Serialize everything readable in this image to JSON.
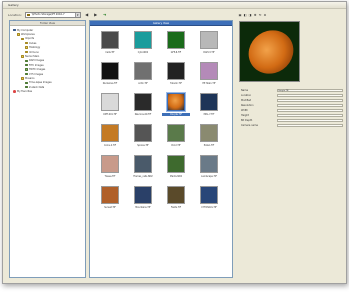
{
  "window": {
    "title": "Gallery"
  },
  "toolbar": {
    "location_label": "Location:",
    "location_value": "\\\\Photo Storage\\PT 2010-7",
    "left_buttons": [
      "◀",
      "▶"
    ],
    "go_icon": "green-arrow-icon"
  },
  "tree": {
    "header": "Folder View",
    "items": [
      {
        "label": "My Computer",
        "icon": "pc",
        "indent": 0
      },
      {
        "label": "Workplaces",
        "icon": "folder",
        "indent": 1
      },
      {
        "label": "Imports",
        "icon": "folder",
        "indent": 2
      },
      {
        "label": "Cubes",
        "icon": "folder",
        "indent": 3
      },
      {
        "label": "Histology",
        "icon": "folder",
        "indent": 3
      },
      {
        "label": "Immuno",
        "icon": "folder",
        "indent": 3
      },
      {
        "label": "Nuclei Stain",
        "icon": "folder",
        "indent": 2
      },
      {
        "label": "DAPI Images",
        "icon": "img",
        "indent": 3
      },
      {
        "label": "FITC Images",
        "icon": "img",
        "indent": 3
      },
      {
        "label": "TRITC Images",
        "icon": "img",
        "indent": 3
      },
      {
        "label": "CY5 Images",
        "icon": "img",
        "indent": 3
      },
      {
        "label": "Mosaics",
        "icon": "folder",
        "indent": 2
      },
      {
        "label": "Time-lapse Images",
        "icon": "img",
        "indent": 3
      },
      {
        "label": "Z-stack Data",
        "icon": "img",
        "indent": 3
      },
      {
        "label": "My Favorites",
        "icon": "fav",
        "indent": 0
      }
    ]
  },
  "thumbs": {
    "header": "Gallery View",
    "items": [
      {
        "label": "Cells.TIF",
        "swatch": "#4a4a4a"
      },
      {
        "label": "Cyto.ND2",
        "swatch": "#1a9c9c"
      },
      {
        "label": "GFP-R.TIF",
        "swatch": "#1a6b1a"
      },
      {
        "label": "DAPI-3.TIF",
        "swatch": "#b8b8b8"
      },
      {
        "label": "Nucleolus.TIF",
        "swatch": "#111111"
      },
      {
        "label": "Actin.TIF",
        "swatch": "#707070"
      },
      {
        "label": "Tubulin.TIF",
        "swatch": "#222222"
      },
      {
        "label": "HE Stain.TIF",
        "swatch": "#b48ab8"
      },
      {
        "label": "OMT-001.TIF",
        "swatch": "#d9d9d9"
      },
      {
        "label": "Neurons-09.TIF",
        "swatch": "#2a2a2a"
      },
      {
        "label": "Oocyte.TIF",
        "swatch": "#d86a12"
      },
      {
        "label": "Mito-7.TIF",
        "swatch": "#1e3558"
      },
      {
        "label": "Coins-2.TIF",
        "swatch": "#c47a24"
      },
      {
        "label": "Spores.TIF",
        "swatch": "#555555"
      },
      {
        "label": "Pond.TIF",
        "swatch": "#5a7a4a"
      },
      {
        "label": "Pollen.TIF",
        "swatch": "#8a8a70"
      },
      {
        "label": "Tissue.TIF",
        "swatch": "#c89a8a"
      },
      {
        "label": "Frames_cells.ND2",
        "swatch": "#4a5a6a"
      },
      {
        "label": "Plants.ND2",
        "swatch": "#3e6a2e"
      },
      {
        "label": "Landscape.TIF",
        "swatch": "#6a7a88"
      },
      {
        "label": "Sunset.TIF",
        "swatch": "#b0602a"
      },
      {
        "label": "Mountains.TIF",
        "swatch": "#2a4068"
      },
      {
        "label": "Fields.TIF",
        "swatch": "#5a4a2a"
      },
      {
        "label": "CYTOSOLS.TIF",
        "swatch": "#284678"
      }
    ]
  },
  "right": {
    "tools": [
      "▣",
      "◧",
      "◨",
      "✚",
      "⟲",
      "⚙"
    ],
    "properties": [
      {
        "key": "Name",
        "value": "Oocyte.TIF"
      },
      {
        "key": "Location",
        "value": ""
      },
      {
        "key": "Modified",
        "value": ""
      },
      {
        "key": "Resolution",
        "value": ""
      },
      {
        "key": "Width",
        "value": ""
      },
      {
        "key": "Height",
        "value": ""
      },
      {
        "key": "Bit Depth",
        "value": ""
      },
      {
        "key": "Camera name",
        "value": ""
      }
    ]
  }
}
